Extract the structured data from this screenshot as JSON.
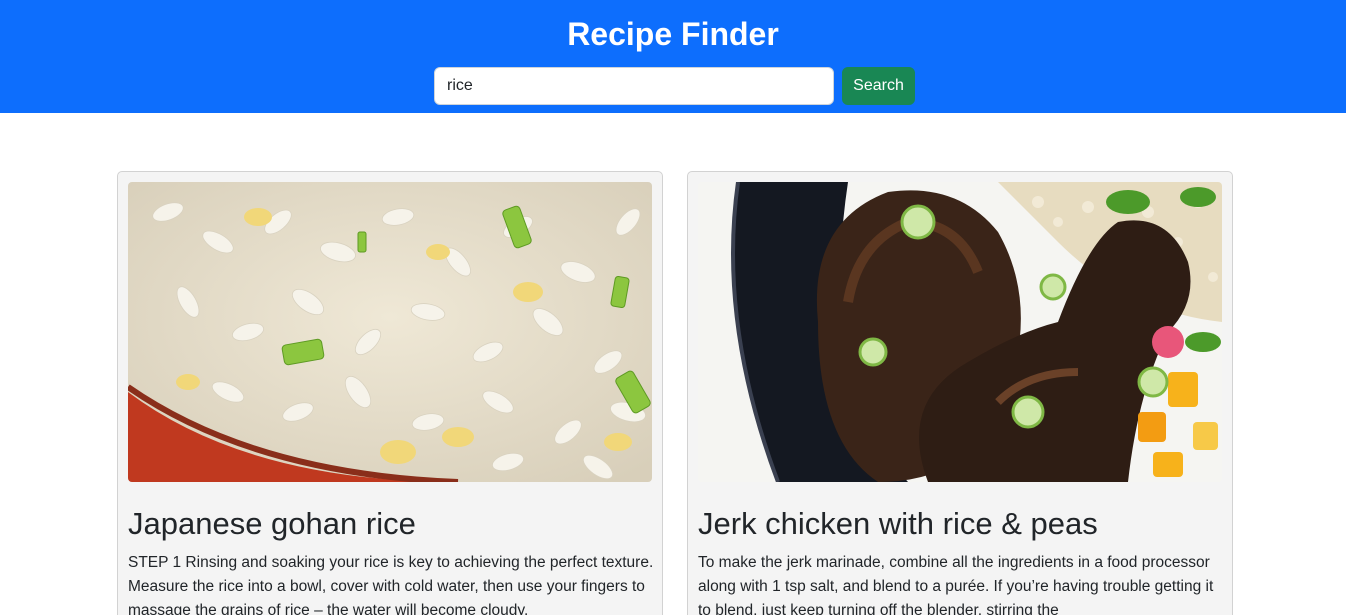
{
  "header": {
    "title": "Recipe Finder",
    "search_value": "rice",
    "search_button_label": "Search"
  },
  "colors": {
    "header_bg": "#0d6efd",
    "search_button_bg": "#198754",
    "card_bg": "#f4f4f4"
  },
  "recipes": [
    {
      "title": "Japanese gohan rice",
      "image_icon": "fried-rice-photo",
      "description": "STEP 1 Rinsing and soaking your rice is key to achieving the perfect texture. Measure the rice into a bowl, cover with cold water, then use your fingers to massage the grains of rice – the water will become cloudy."
    },
    {
      "title": "Jerk chicken with rice & peas",
      "image_icon": "jerk-chicken-photo",
      "description": "To make the jerk marinade, combine all the ingredients in a food processor along with 1 tsp salt, and blend to a purée. If you’re having trouble getting it to blend, just keep turning off the blender, stirring the"
    }
  ]
}
